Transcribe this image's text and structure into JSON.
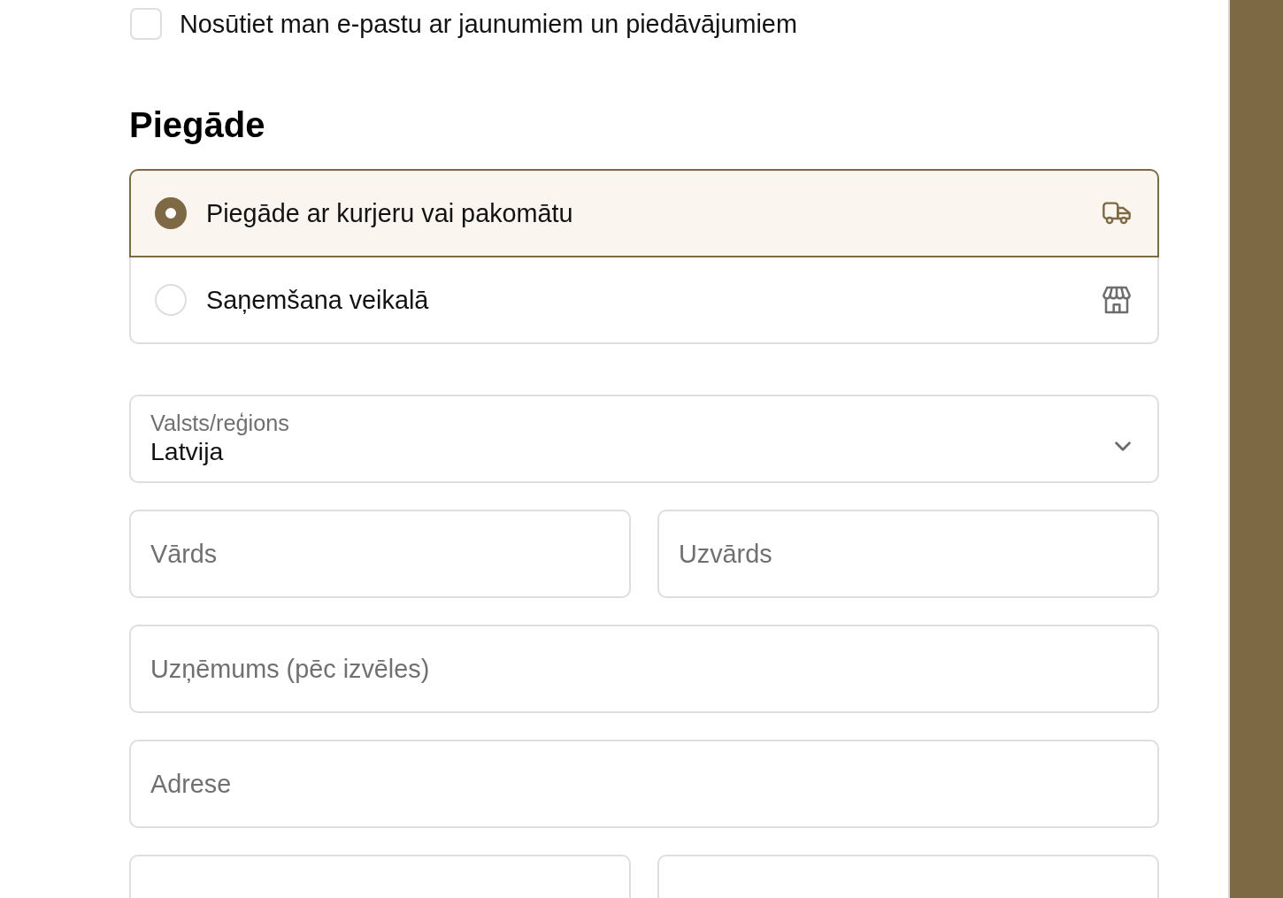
{
  "newsletter": {
    "label": "Nosūtiet man e-pastu ar jaunumiem un piedāvājumiem",
    "checked": false
  },
  "delivery": {
    "heading": "Piegāde",
    "options": [
      {
        "kind": "courier",
        "label": "Piegāde ar kurjeru vai pakomātu",
        "selected": true
      },
      {
        "kind": "store",
        "label": "Saņemšana veikalā",
        "selected": false
      }
    ]
  },
  "address_form": {
    "rows": [
      {
        "fields": [
          {
            "kind": "select",
            "label": "Valsts/reģions",
            "value": "Latvija"
          }
        ]
      },
      {
        "fields": [
          {
            "kind": "text",
            "placeholder": "Vārds"
          },
          {
            "kind": "text",
            "placeholder": "Uzvārds"
          }
        ]
      },
      {
        "fields": [
          {
            "kind": "text",
            "placeholder": "Uzņēmums (pēc izvēles)"
          }
        ]
      },
      {
        "fields": [
          {
            "kind": "text",
            "placeholder": "Adrese"
          }
        ]
      },
      {
        "fields": [
          {
            "kind": "text"
          },
          {
            "kind": "text"
          }
        ]
      }
    ]
  }
}
